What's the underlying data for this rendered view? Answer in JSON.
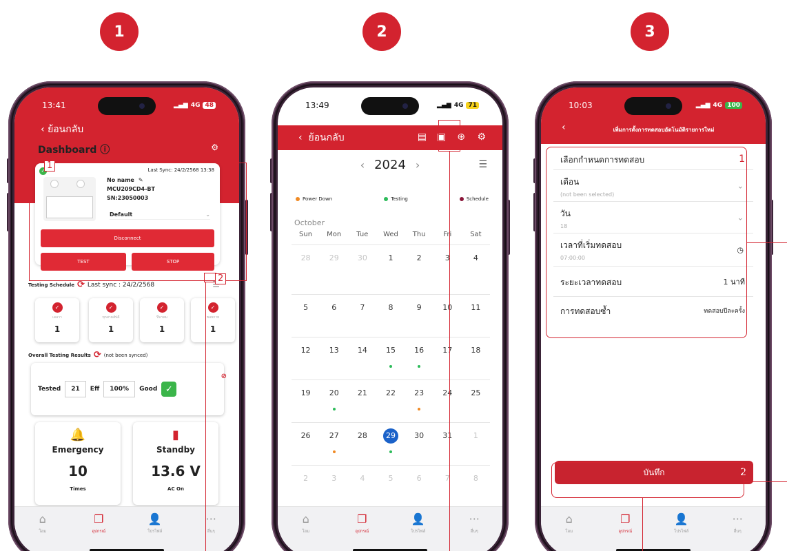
{
  "steps": [
    "1",
    "2",
    "3"
  ],
  "phone1": {
    "time": "13:41",
    "signal": "4G",
    "battery": "48",
    "back_label": "ย้อนกลับ",
    "title": "Dashboard",
    "device": {
      "last_sync": "Last Sync: 24/2/2568 13:38",
      "name": "No name",
      "model": "MCU209CD4-BT",
      "serial": "SN:23050003",
      "profile": "Default"
    },
    "disconnect_label": "Disconnect",
    "test_label": "TEST",
    "stop_label": "STOP",
    "schedule_title": "Testing Schedule",
    "schedule_sync": "Last sync : 24/2/2568",
    "schedule_cards": [
      {
        "caption": "เดลวา",
        "value": "1"
      },
      {
        "caption": "ทุกสามสัปดี",
        "value": "1"
      },
      {
        "caption": "ปีบาคม",
        "value": "1"
      },
      {
        "caption": "ขอยกาย",
        "value": "1"
      }
    ],
    "results_title": "Overall Testing Results",
    "results_sync": "(not been synced)",
    "tested_label": "Tested",
    "tested_value": "21",
    "eff_label": "Eff",
    "eff_value": "100%",
    "good_label": "Good",
    "emergency_label": "Emergency",
    "emergency_value": "10",
    "emergency_unit": "Times",
    "standby_label": "Standby",
    "standby_value": "13.6 V",
    "standby_unit": "AC On",
    "annotation_1": "1",
    "annotation_2": "2"
  },
  "phone2": {
    "time": "13:49",
    "signal": "4G",
    "battery": "71",
    "back_label": "ย้อนกลับ",
    "year": "2024",
    "legend": {
      "power_down": "Power Down",
      "testing": "Testing",
      "schedule": "Schedule"
    },
    "month": "October",
    "weekdays": [
      "Sun",
      "Mon",
      "Tue",
      "Wed",
      "Thu",
      "Fri",
      "Sat"
    ],
    "weeks": [
      [
        "28",
        "29",
        "30",
        "1",
        "2",
        "3",
        "4"
      ],
      [
        "5",
        "6",
        "7",
        "8",
        "9",
        "10",
        "11"
      ],
      [
        "12",
        "13",
        "14",
        "15",
        "16",
        "17",
        "18"
      ],
      [
        "19",
        "20",
        "21",
        "22",
        "23",
        "24",
        "25"
      ],
      [
        "26",
        "27",
        "28",
        "29",
        "30",
        "31",
        "1"
      ],
      [
        "2",
        "3",
        "4",
        "5",
        "6",
        "7",
        "8"
      ]
    ]
  },
  "phone3": {
    "time": "10:03",
    "signal": "4G",
    "battery": "100",
    "title": "เพิ่มการตั้งการทดสอบอัตโนมัติรายการใหม่",
    "section_label": "เลือกกำหนดการทดสอบ",
    "section_badge": "1",
    "month_label": "เดือน",
    "month_value": "(not been selected)",
    "day_label": "วัน",
    "day_value": "18",
    "start_label": "เวลาที่เริ่มทดสอบ",
    "start_value": "07:00:00",
    "duration_label": "ระยะเวลาทดสอบ",
    "duration_value": "1 นาที",
    "repeat_label": "การทดสอบซ้ำ",
    "repeat_value": "ทดสอบปีละครั้ง",
    "save_label": "บันทึก",
    "save_badge": "2"
  },
  "tabs": [
    "โฮม",
    "อุปกรณ์",
    "โปรไฟล์",
    "อื่นๆ"
  ],
  "colors": {
    "accent": "#d3232f",
    "testing": "#2dbb5a",
    "power_down": "#f08a24",
    "schedule": "#8a1538",
    "today": "#1b62c9"
  }
}
